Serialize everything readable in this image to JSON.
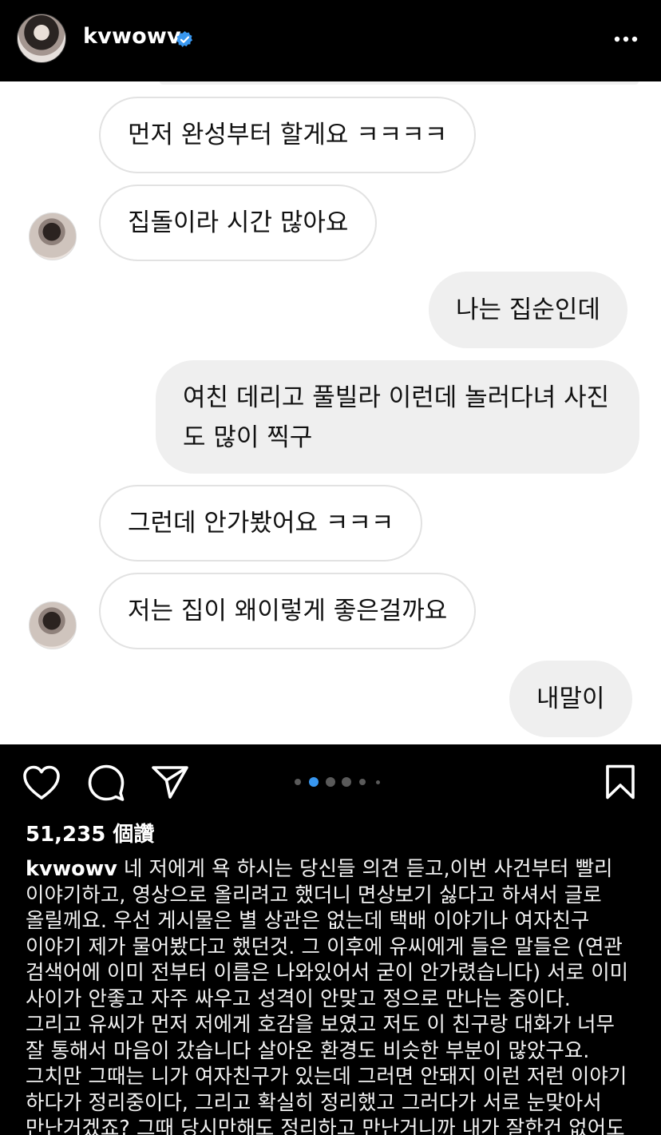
{
  "header": {
    "username": "kvwowv",
    "verified_icon": "verified-badge-icon",
    "more_icon": "more-horizontal-icon"
  },
  "chat": {
    "messages": [
      {
        "side": "in",
        "text": "먼저 완성부터 할게요 ㅋㅋㅋㅋ"
      },
      {
        "side": "in",
        "text": "집돌이라 시간 많아요"
      },
      {
        "side": "out",
        "text": "나는 집순인데"
      },
      {
        "side": "out",
        "text": "여친 데리고 풀빌라 이런데 놀러다녀 사진도 많이 찍구"
      },
      {
        "side": "in",
        "text": "그런데 안가봤어요 ㅋㅋㅋ"
      },
      {
        "side": "in",
        "text": "저는 집이 왜이렇게 좋은걸까요"
      },
      {
        "side": "out",
        "text": "내말이"
      }
    ]
  },
  "actions": {
    "like_icon": "heart-icon",
    "comment_icon": "comment-icon",
    "share_icon": "send-icon",
    "save_icon": "bookmark-icon",
    "carousel": {
      "total": 6,
      "active": 2
    }
  },
  "post": {
    "likes": "51,235 個讚",
    "caption_user": "kvwowv",
    "caption_text": "네 저에게 욕 하시는 당신들 의견 듣고,이번 사건부터 빨리 이야기하고, 영상으로 올리려고 했더니 면상보기 싫다고 하셔서 글로 올릴께요. 우선 게시물은 별 상관은 없는데 택배 이야기나 여자친구 이야기 제가 물어봤다고 했던것. 그 이후에 유씨에게 들은 말들은 (연관 검색어에 이미 전부터 이름은 나와있어서 굳이 안가렸습니다) 서로 이미 사이가 안좋고 자주 싸우고 성격이 안맞고 정으로 만나는 중이다. 그리고 유씨가 먼저 저에게 호감을 보였고 저도 이 친구랑 대화가 너무 잘 통해서 마음이 갔습니다 살아온 환경도 비슷한 부분이 많았구요. 그치만 그때는 니가 여자친구가 있는데 그러면 안돼지 이런 저런 이야기 하다가 정리중이다, 그리고 확실히 정리했고 그러다가 서로 눈맞아서 만난거겠죠? 그때 당시만해도 정리하고 만난거니까 내가 잘한건 없어도"
  }
}
